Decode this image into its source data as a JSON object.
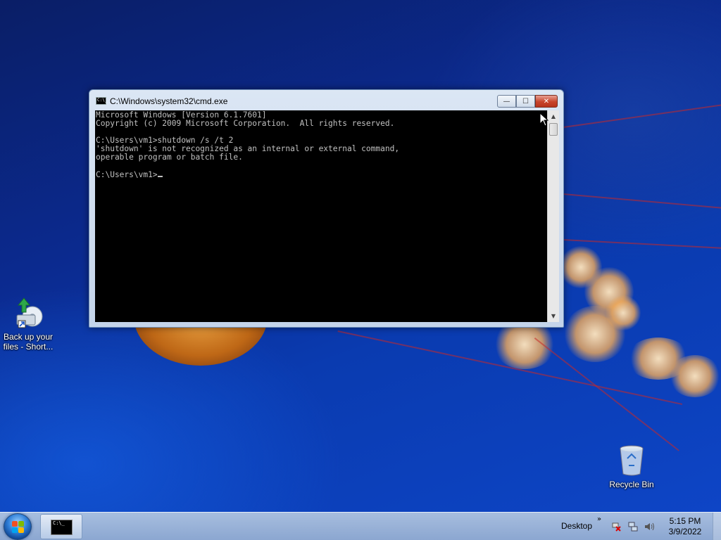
{
  "desktop": {
    "icons": [
      {
        "label": "Back up your files - Short...",
        "icon": "backup-shortcut-icon"
      },
      {
        "label": "Recycle Bin",
        "icon": "recycle-bin-icon"
      }
    ]
  },
  "cmd_window": {
    "title": "C:\\Windows\\system32\\cmd.exe",
    "icon_text": "C:\\_",
    "buttons": {
      "minimize": "—",
      "maximize": "☐",
      "close": "✕"
    },
    "console_lines": [
      "Microsoft Windows [Version 6.1.7601]",
      "Copyright (c) 2009 Microsoft Corporation.  All rights reserved.",
      "",
      "C:\\Users\\vm1>shutdown /s /t 2",
      "'shutdown' is not recognized as an internal or external command,",
      "operable program or batch file.",
      ""
    ],
    "prompt": "C:\\Users\\vm1>"
  },
  "taskbar": {
    "start_icon": "windows-start-orb",
    "task_cmd_icon_text": "C:\\_",
    "desktop_label": "Desktop",
    "chevron": "»",
    "tray_icons": [
      "action-center-icon",
      "network-icon",
      "volume-icon"
    ],
    "time": "5:15 PM",
    "date": "3/9/2022"
  },
  "colors": {
    "console_bg": "#000000",
    "console_text": "#c0c0c0",
    "close_button": "#c7432b"
  }
}
